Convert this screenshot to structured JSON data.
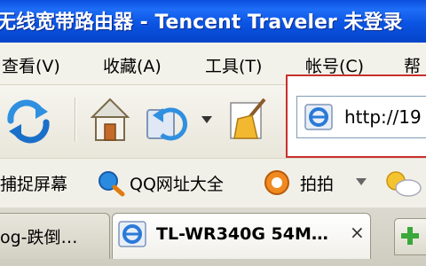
{
  "window": {
    "title": "无线宽带路由器 - Tencent Traveler 未登录"
  },
  "menu": {
    "items": [
      {
        "label": "查看(V)"
      },
      {
        "label": "收藏(A)"
      },
      {
        "label": "工具(T)"
      },
      {
        "label": "帐号(C)"
      },
      {
        "label": "帮"
      }
    ]
  },
  "toolbar": {
    "buttons": [
      "refresh-icon",
      "home-icon",
      "undo-icon",
      "clean-icon"
    ]
  },
  "address": {
    "value": "http://19"
  },
  "links": {
    "items": [
      {
        "label": "捕捉屏幕"
      },
      {
        "label": "QQ网址大全"
      },
      {
        "label": "拍拍"
      }
    ]
  },
  "tabs": {
    "items": [
      {
        "label": "og-跌倒…"
      },
      {
        "label": "TL-WR340G 54M…"
      }
    ],
    "close_label": "×"
  },
  "colors": {
    "titlebar": "#0b54e3",
    "highlight_border": "#c9302c"
  }
}
